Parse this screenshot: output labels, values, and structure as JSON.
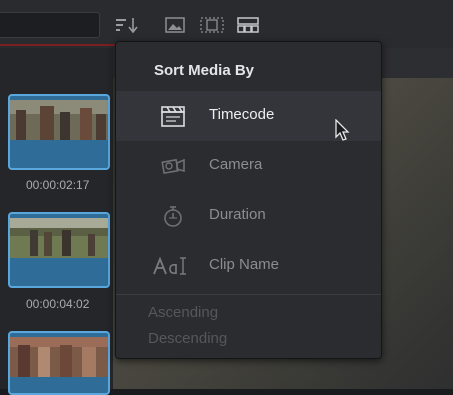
{
  "toolbar": {
    "sort_icon": "sort-descending-icon",
    "view_icons": [
      "image-view-icon",
      "filmstrip-view-icon",
      "thumbnail-grid-icon"
    ]
  },
  "clips": [
    {
      "timecode": "00:00:02:17"
    },
    {
      "timecode": "00:00:04:02"
    }
  ],
  "menu": {
    "title": "Sort Media By",
    "items": [
      {
        "label": "Timecode",
        "icon": "clapperboard-icon"
      },
      {
        "label": "Camera",
        "icon": "camera-icon"
      },
      {
        "label": "Duration",
        "icon": "stopwatch-icon"
      },
      {
        "label": "Clip Name",
        "icon": "text-cursor-icon"
      }
    ],
    "order": {
      "ascending": "Ascending",
      "descending": "Descending"
    }
  },
  "colors": {
    "accent": "#5aa7de",
    "menu_bg": "#2b2c30",
    "selected_bg": "#33353a"
  }
}
